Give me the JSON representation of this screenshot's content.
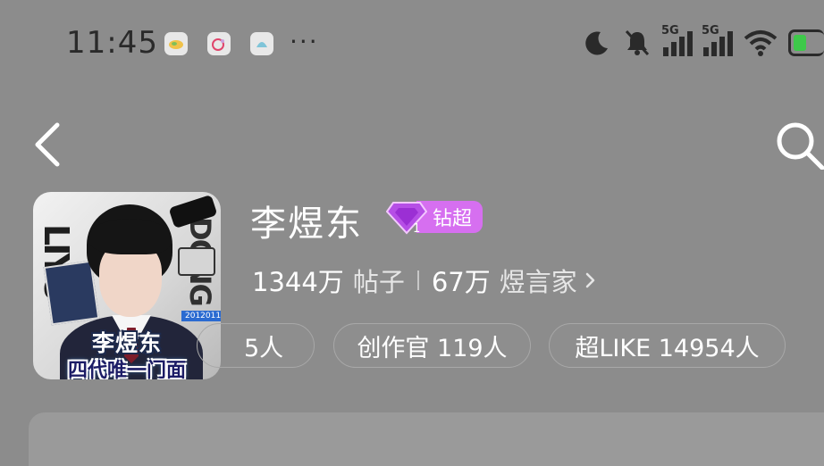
{
  "status_bar": {
    "time": "11:45",
    "notification_apps": [
      "weibo-cloud-icon",
      "weibo-app-icon",
      "weibo-lite-icon"
    ],
    "more": "···",
    "signal_1_label": "5G",
    "signal_2_label": "5G"
  },
  "nav": {
    "back_icon": "chevron-left-icon",
    "search_icon": "search-icon"
  },
  "profile": {
    "name": "李煜东",
    "badge_label": "钻超",
    "badge_level": "1",
    "avatar_caption_name": "李煜东",
    "avatar_caption_line": "四代唯一门面",
    "avatar_side_left": "LIYU",
    "avatar_side_right": "DONG",
    "avatar_date": "2012011"
  },
  "stats": {
    "posts_num": "1344万",
    "posts_label": "帖子",
    "fans_num": "67万",
    "fans_label": "煜言家"
  },
  "chips": [
    {
      "label": "5人"
    },
    {
      "label": "创作官 119人"
    },
    {
      "label": "超LIKE 14954人"
    }
  ],
  "colors": {
    "background": "#8c8c8c",
    "badge": "#d66ff0",
    "battery_fill": "#3ec94a"
  }
}
